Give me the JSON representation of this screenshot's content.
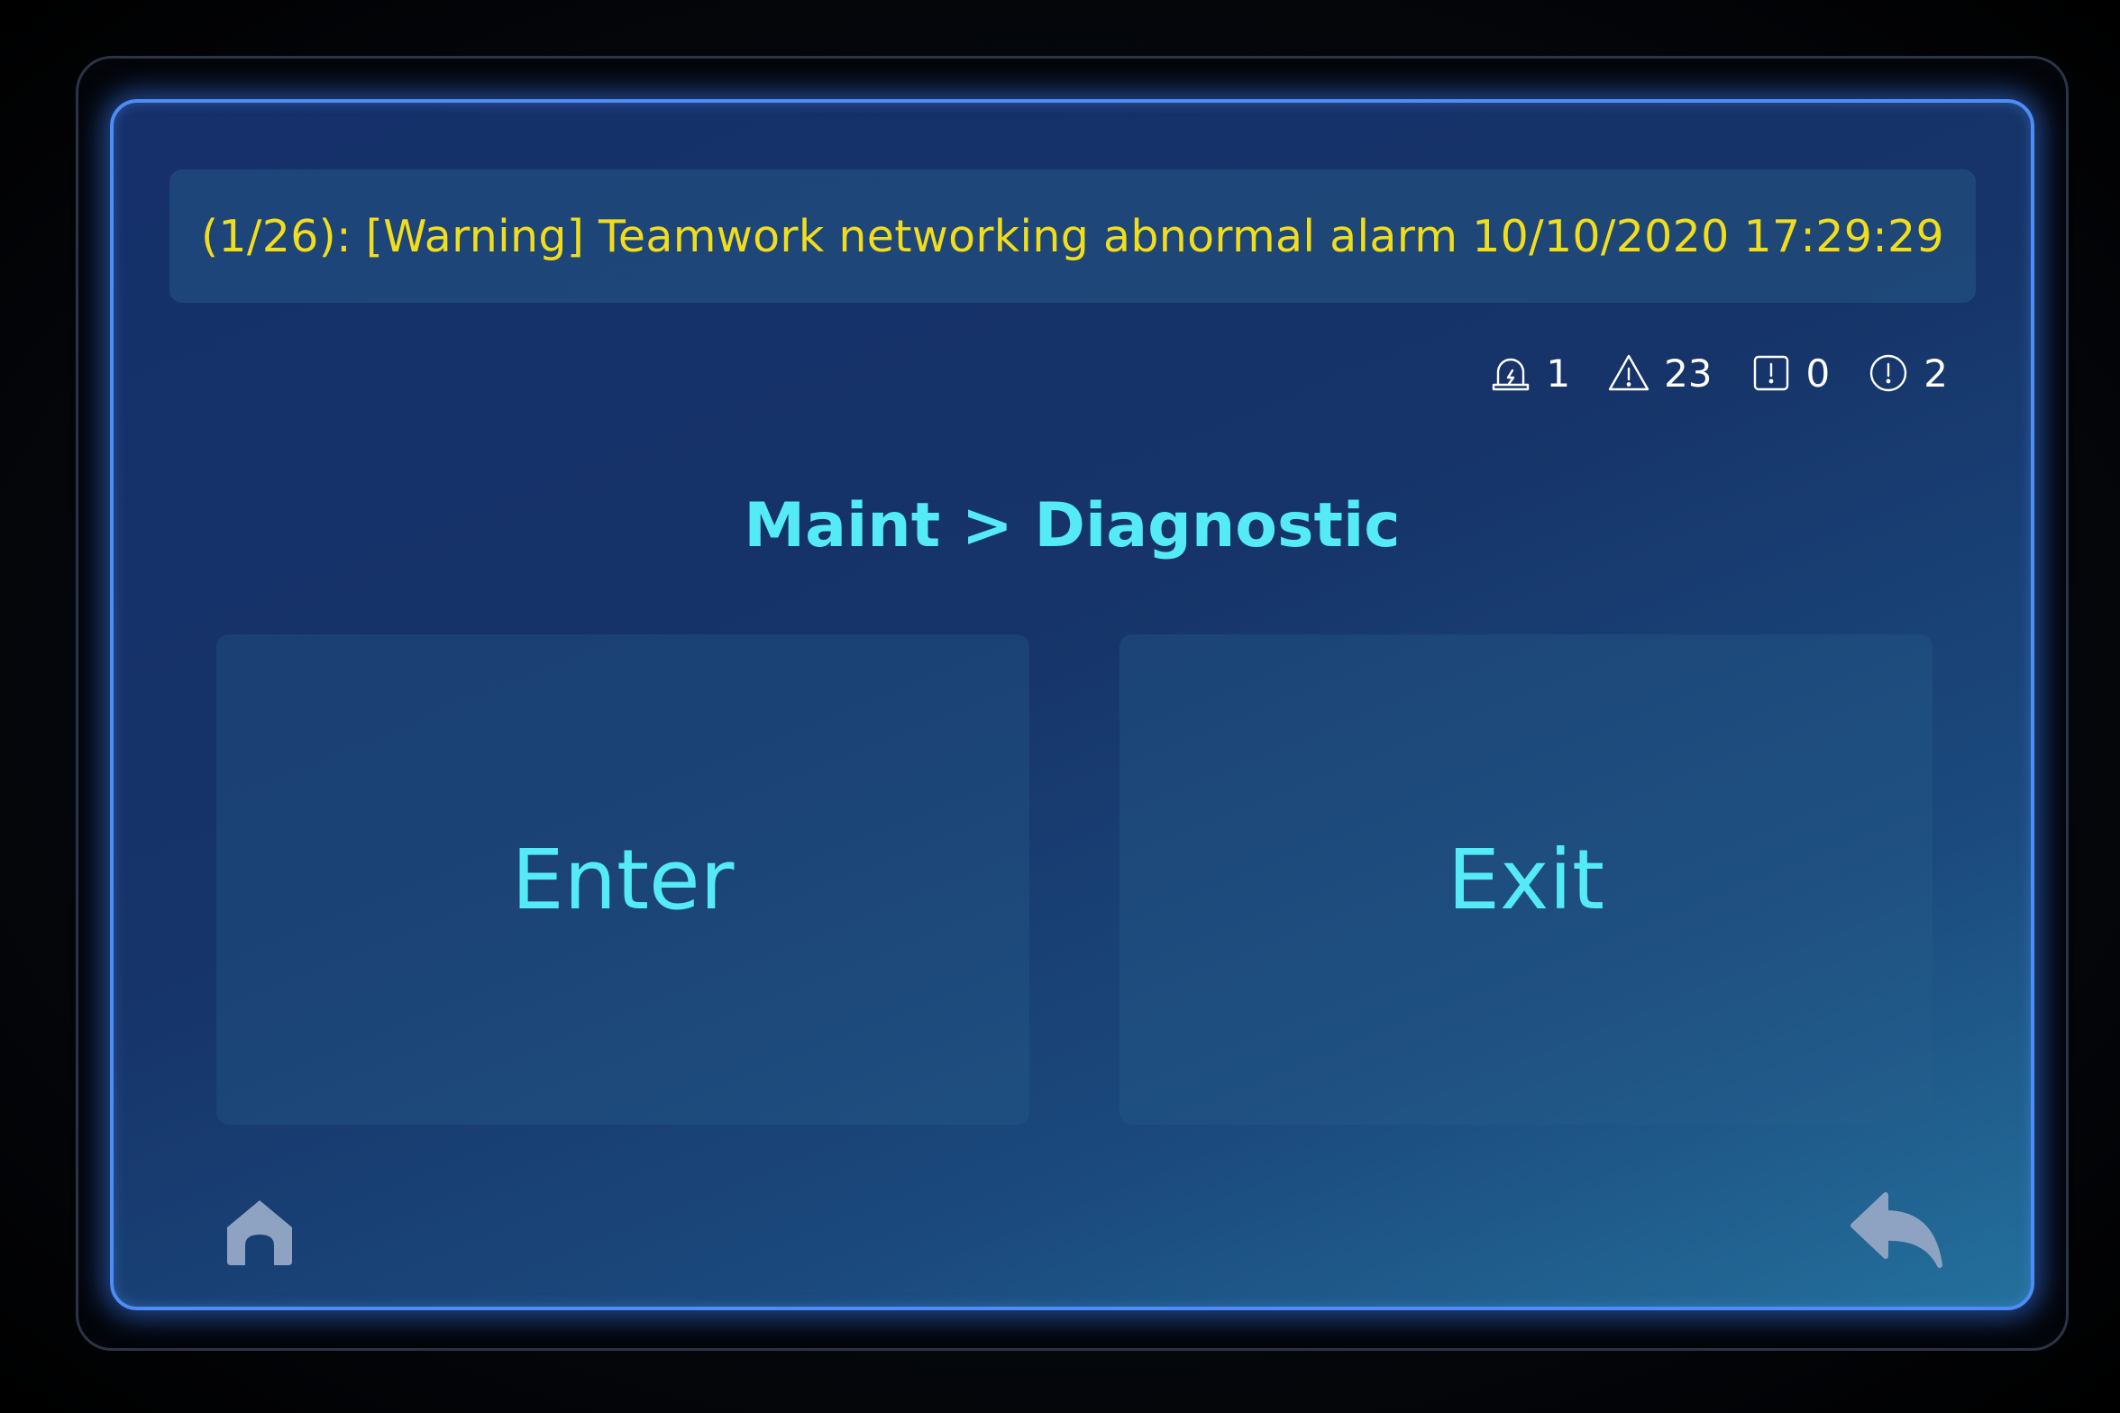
{
  "alarm_banner": {
    "text": "(1/26): [Warning] Teamwork networking abnormal alarm 10/10/2020 17:29:29",
    "color": "#f2dd1c"
  },
  "status": {
    "items": [
      {
        "icon": "siren-icon",
        "count": "1"
      },
      {
        "icon": "warning-triangle-icon",
        "count": "23"
      },
      {
        "icon": "alert-square-icon",
        "count": "0"
      },
      {
        "icon": "alert-circle-icon",
        "count": "2"
      }
    ]
  },
  "breadcrumb": {
    "text": "Maint > Diagnostic"
  },
  "actions": {
    "enter_label": "Enter",
    "exit_label": "Exit"
  },
  "nav": {
    "home_icon": "home-icon",
    "back_icon": "back-arrow-icon"
  },
  "colors": {
    "accent": "#55ebf6",
    "frame": "#4d8df5",
    "nav_icon": "#8ea3c2"
  }
}
